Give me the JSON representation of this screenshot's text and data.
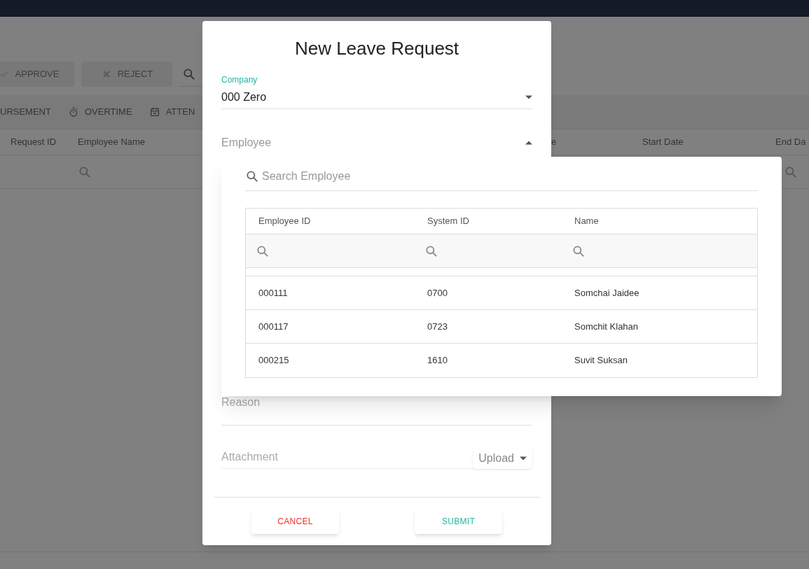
{
  "toolbar": {
    "buttons": [
      {
        "label": "APPROVE",
        "kind": "check",
        "disabled": true
      },
      {
        "label": "REJECT",
        "kind": "cross",
        "disabled": true
      }
    ]
  },
  "tabs": [
    {
      "label": "URSEMENT",
      "kind": "none"
    },
    {
      "label": "OVERTIME",
      "kind": "timer"
    },
    {
      "label": "ATTEN",
      "kind": "calendar"
    }
  ],
  "table": {
    "columns": [
      {
        "label": "Request ID",
        "filter": false
      },
      {
        "label": "Employee Name",
        "filter": true
      },
      {
        "label": "e",
        "filter": false
      },
      {
        "label": "Start Date",
        "filter": false
      },
      {
        "label": "End Da",
        "filter": true
      }
    ]
  },
  "dialog": {
    "title": "New Leave Request",
    "company": {
      "label": "Company",
      "value": "000 Zero"
    },
    "employee": {
      "label": "Employee",
      "expanded": true
    },
    "reason": {
      "label": "Reason"
    },
    "attachment": {
      "label": "Attachment",
      "button": "Upload"
    },
    "buttons": [
      {
        "label": "CANCEL",
        "kind": "cancel"
      },
      {
        "label": "SUBMIT",
        "kind": "submit"
      }
    ]
  },
  "employee_dropdown": {
    "search": {
      "placeholder": "Search Employee"
    },
    "columns": [
      "Employee ID",
      "System ID",
      "Name"
    ],
    "rows": [
      {
        "cells": [
          "000111",
          "0700",
          "Somchai Jaidee"
        ]
      },
      {
        "cells": [
          "000117",
          "0723",
          "Somchit Klahan"
        ]
      },
      {
        "cells": [
          "000215",
          "1610",
          "Suvit Suksan"
        ]
      }
    ]
  }
}
